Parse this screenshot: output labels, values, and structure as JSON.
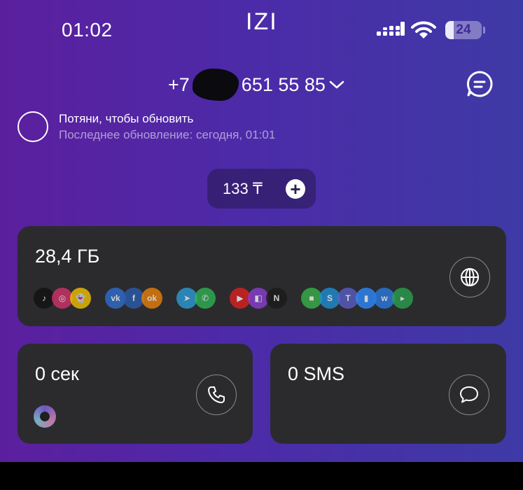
{
  "status_bar": {
    "time": "01:02",
    "brand": "IZI",
    "battery_level": "24",
    "battery_fraction": 0.24
  },
  "header": {
    "phone_prefix": "+7",
    "phone_suffix": "651 55 85"
  },
  "refresh": {
    "title": "Потяни, чтобы обновить",
    "subtitle": "Последнее обновление: сегодня, 01:01"
  },
  "balance": {
    "amount": "133 ₸"
  },
  "cards": {
    "internet": {
      "value": "28,4 ГБ"
    },
    "calls": {
      "value": "0 сек"
    },
    "sms": {
      "value": "0 SMS"
    }
  },
  "apps": [
    {
      "name": "tiktok-icon",
      "glyph": "♪",
      "color": "#111111"
    },
    {
      "name": "instagram-icon",
      "glyph": "◎",
      "color": "#d6336c"
    },
    {
      "name": "snapchat-icon",
      "glyph": "👻",
      "color": "#f5c400"
    },
    {
      "name": "vk-icon",
      "glyph": "vk",
      "color": "#2f6fd1"
    },
    {
      "name": "facebook-icon",
      "glyph": "f",
      "color": "#2a5db0"
    },
    {
      "name": "odnoklassniki-icon",
      "glyph": "ok",
      "color": "#ee8208"
    },
    {
      "name": "telegram-icon",
      "glyph": "➤",
      "color": "#2b9ed9"
    },
    {
      "name": "whatsapp-icon",
      "glyph": "✆",
      "color": "#2fb553"
    },
    {
      "name": "youtube-icon",
      "glyph": "▶",
      "color": "#e02020"
    },
    {
      "name": "twitch-icon",
      "glyph": "◧",
      "color": "#8b3fd6"
    },
    {
      "name": "netflix-icon",
      "glyph": "N",
      "color": "#1a1a1a"
    },
    {
      "name": "facetime-icon",
      "glyph": "■",
      "color": "#38b54a"
    },
    {
      "name": "skype-icon",
      "glyph": "S",
      "color": "#1f8fd8"
    },
    {
      "name": "teams-icon",
      "glyph": "T",
      "color": "#5b5fc7"
    },
    {
      "name": "zoom-icon",
      "glyph": "▮",
      "color": "#2d8cff"
    },
    {
      "name": "webex-icon",
      "glyph": "w",
      "color": "#2a7be4"
    },
    {
      "name": "google-meet-icon",
      "glyph": "▸",
      "color": "#2aa34f"
    }
  ]
}
